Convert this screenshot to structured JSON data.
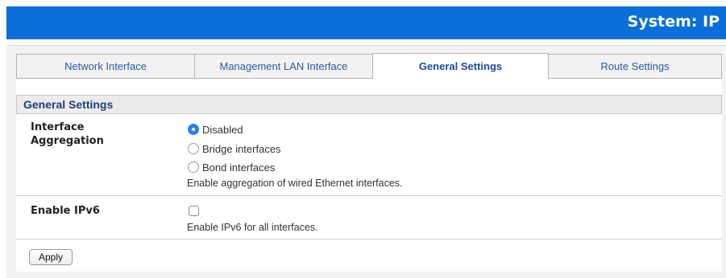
{
  "header": {
    "title": "System: IP",
    "color": "#0a6fd8"
  },
  "tabs": [
    {
      "label": "Network Interface",
      "active": false
    },
    {
      "label": "Management LAN Interface",
      "active": false
    },
    {
      "label": "General Settings",
      "active": true
    },
    {
      "label": "Route Settings",
      "active": false
    }
  ],
  "section": {
    "title": "General Settings"
  },
  "interface_aggregation": {
    "label": "Interface Aggregation",
    "options": [
      {
        "label": "Disabled",
        "selected": true
      },
      {
        "label": "Bridge interfaces",
        "selected": false
      },
      {
        "label": "Bond interfaces",
        "selected": false
      }
    ],
    "help": "Enable aggregation of wired Ethernet interfaces."
  },
  "enable_ipv6": {
    "label": "Enable IPv6",
    "checked": false,
    "help": "Enable IPv6 for all interfaces."
  },
  "apply_label": "Apply"
}
